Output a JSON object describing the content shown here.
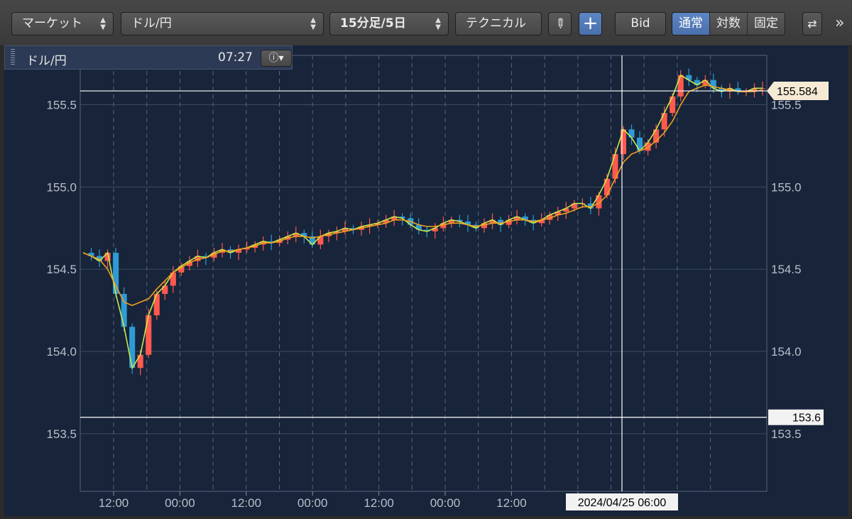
{
  "toolbar": {
    "market_label": "マーケット",
    "pair_label": "ドル/円",
    "period_label": "15分足/5日",
    "technical_label": "テクニカル",
    "bid_label": "Bid",
    "scale_options": [
      "通常",
      "対数",
      "固定"
    ],
    "scale_selected": "通常",
    "more_label": "»"
  },
  "legend": {
    "symbol": "ドル/円",
    "time": "07:27"
  },
  "colors": {
    "up": "#ff5a4e",
    "down": "#2e9bd6",
    "ma_short": "#c8e84a",
    "ma_long": "#f0a020",
    "accent": "#4e78b8"
  },
  "crosshair": {
    "date_label": "2024/04/25 06:00",
    "price_label": "153.6"
  },
  "chart_data": {
    "type": "line",
    "title": "",
    "series": [
      {
        "values": [
          154.6,
          154.58,
          154.55,
          154.6,
          154.35,
          154.15,
          153.9,
          153.98,
          154.22,
          154.35,
          154.4,
          154.48,
          154.52,
          154.55,
          154.58,
          154.57,
          154.6,
          154.62,
          154.6,
          154.62,
          154.63,
          154.65,
          154.67,
          154.66,
          154.68,
          154.7,
          154.72,
          154.7,
          154.65,
          154.7,
          154.72,
          154.73,
          154.75,
          154.74,
          154.76,
          154.77,
          154.78,
          154.8,
          154.82,
          154.81,
          154.77,
          154.74,
          154.73,
          154.75,
          154.78,
          154.8,
          154.79,
          154.77,
          154.75,
          154.78,
          154.8,
          154.77,
          154.8,
          154.82,
          154.8,
          154.78,
          154.8,
          154.83,
          154.85,
          154.87,
          154.9,
          154.9,
          154.87,
          154.95,
          155.05,
          155.2,
          155.35,
          155.3,
          155.22,
          155.27,
          155.35,
          155.45,
          155.55,
          155.68,
          155.65,
          155.62,
          155.65,
          155.6,
          155.58,
          155.6,
          155.58,
          155.58,
          155.6,
          155.6
        ]
      },
      {
        "values": [
          154.6,
          154.58,
          154.56,
          154.5,
          154.4,
          154.3,
          154.28,
          154.3,
          154.32,
          154.38,
          154.43,
          154.48,
          154.51,
          154.54,
          154.56,
          154.57,
          154.59,
          154.61,
          154.61,
          154.62,
          154.63,
          154.64,
          154.66,
          154.66,
          154.67,
          154.69,
          154.7,
          154.7,
          154.69,
          154.7,
          154.71,
          154.72,
          154.73,
          154.74,
          154.75,
          154.76,
          154.77,
          154.78,
          154.8,
          154.8,
          154.79,
          154.77,
          154.76,
          154.76,
          154.77,
          154.78,
          154.78,
          154.77,
          154.76,
          154.77,
          154.78,
          154.78,
          154.79,
          154.8,
          154.8,
          154.79,
          154.8,
          154.81,
          154.83,
          154.84,
          154.86,
          154.88,
          154.88,
          154.9,
          154.95,
          155.05,
          155.15,
          155.2,
          155.22,
          155.24,
          155.28,
          155.33,
          155.4,
          155.5,
          155.58,
          155.6,
          155.62,
          155.61,
          155.6,
          155.59,
          155.58,
          155.58,
          155.58,
          155.59
        ]
      }
    ],
    "ylim": [
      153.15,
      155.8
    ],
    "y_ticks": [
      "153.5",
      "154.0",
      "154.5",
      "155.0",
      "155.5"
    ],
    "y_tick_values": [
      153.5,
      154.0,
      154.5,
      155.0,
      155.5
    ],
    "x_ticks": [
      "12:00",
      "00:00",
      "12:00",
      "00:00",
      "12:00",
      "00:00",
      "12:00",
      "",
      "00:00"
    ],
    "last_price_label": "155.584",
    "last_price": 155.584,
    "ref_price": 153.6
  }
}
